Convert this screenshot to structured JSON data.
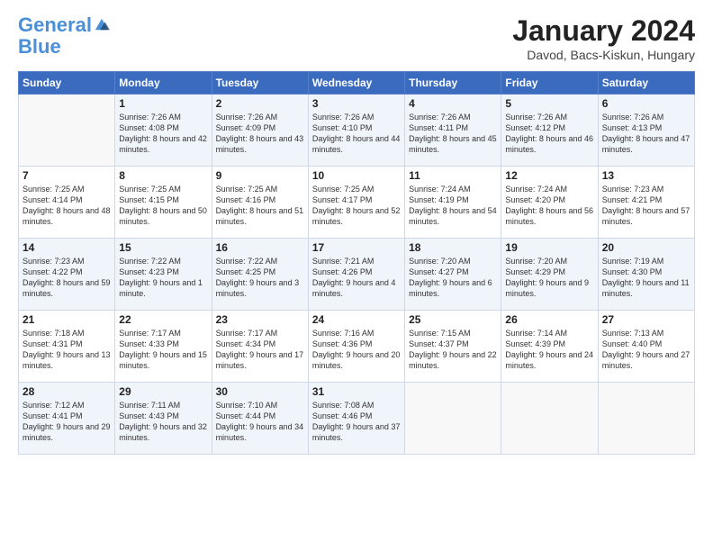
{
  "header": {
    "logo_line1": "General",
    "logo_line2": "Blue",
    "month": "January 2024",
    "location": "Davod, Bacs-Kiskun, Hungary"
  },
  "weekdays": [
    "Sunday",
    "Monday",
    "Tuesday",
    "Wednesday",
    "Thursday",
    "Friday",
    "Saturday"
  ],
  "weeks": [
    [
      {
        "day": "",
        "sunrise": "",
        "sunset": "",
        "daylight": ""
      },
      {
        "day": "1",
        "sunrise": "Sunrise: 7:26 AM",
        "sunset": "Sunset: 4:08 PM",
        "daylight": "Daylight: 8 hours and 42 minutes."
      },
      {
        "day": "2",
        "sunrise": "Sunrise: 7:26 AM",
        "sunset": "Sunset: 4:09 PM",
        "daylight": "Daylight: 8 hours and 43 minutes."
      },
      {
        "day": "3",
        "sunrise": "Sunrise: 7:26 AM",
        "sunset": "Sunset: 4:10 PM",
        "daylight": "Daylight: 8 hours and 44 minutes."
      },
      {
        "day": "4",
        "sunrise": "Sunrise: 7:26 AM",
        "sunset": "Sunset: 4:11 PM",
        "daylight": "Daylight: 8 hours and 45 minutes."
      },
      {
        "day": "5",
        "sunrise": "Sunrise: 7:26 AM",
        "sunset": "Sunset: 4:12 PM",
        "daylight": "Daylight: 8 hours and 46 minutes."
      },
      {
        "day": "6",
        "sunrise": "Sunrise: 7:26 AM",
        "sunset": "Sunset: 4:13 PM",
        "daylight": "Daylight: 8 hours and 47 minutes."
      }
    ],
    [
      {
        "day": "7",
        "sunrise": "Sunrise: 7:25 AM",
        "sunset": "Sunset: 4:14 PM",
        "daylight": "Daylight: 8 hours and 48 minutes."
      },
      {
        "day": "8",
        "sunrise": "Sunrise: 7:25 AM",
        "sunset": "Sunset: 4:15 PM",
        "daylight": "Daylight: 8 hours and 50 minutes."
      },
      {
        "day": "9",
        "sunrise": "Sunrise: 7:25 AM",
        "sunset": "Sunset: 4:16 PM",
        "daylight": "Daylight: 8 hours and 51 minutes."
      },
      {
        "day": "10",
        "sunrise": "Sunrise: 7:25 AM",
        "sunset": "Sunset: 4:17 PM",
        "daylight": "Daylight: 8 hours and 52 minutes."
      },
      {
        "day": "11",
        "sunrise": "Sunrise: 7:24 AM",
        "sunset": "Sunset: 4:19 PM",
        "daylight": "Daylight: 8 hours and 54 minutes."
      },
      {
        "day": "12",
        "sunrise": "Sunrise: 7:24 AM",
        "sunset": "Sunset: 4:20 PM",
        "daylight": "Daylight: 8 hours and 56 minutes."
      },
      {
        "day": "13",
        "sunrise": "Sunrise: 7:23 AM",
        "sunset": "Sunset: 4:21 PM",
        "daylight": "Daylight: 8 hours and 57 minutes."
      }
    ],
    [
      {
        "day": "14",
        "sunrise": "Sunrise: 7:23 AM",
        "sunset": "Sunset: 4:22 PM",
        "daylight": "Daylight: 8 hours and 59 minutes."
      },
      {
        "day": "15",
        "sunrise": "Sunrise: 7:22 AM",
        "sunset": "Sunset: 4:23 PM",
        "daylight": "Daylight: 9 hours and 1 minute."
      },
      {
        "day": "16",
        "sunrise": "Sunrise: 7:22 AM",
        "sunset": "Sunset: 4:25 PM",
        "daylight": "Daylight: 9 hours and 3 minutes."
      },
      {
        "day": "17",
        "sunrise": "Sunrise: 7:21 AM",
        "sunset": "Sunset: 4:26 PM",
        "daylight": "Daylight: 9 hours and 4 minutes."
      },
      {
        "day": "18",
        "sunrise": "Sunrise: 7:20 AM",
        "sunset": "Sunset: 4:27 PM",
        "daylight": "Daylight: 9 hours and 6 minutes."
      },
      {
        "day": "19",
        "sunrise": "Sunrise: 7:20 AM",
        "sunset": "Sunset: 4:29 PM",
        "daylight": "Daylight: 9 hours and 9 minutes."
      },
      {
        "day": "20",
        "sunrise": "Sunrise: 7:19 AM",
        "sunset": "Sunset: 4:30 PM",
        "daylight": "Daylight: 9 hours and 11 minutes."
      }
    ],
    [
      {
        "day": "21",
        "sunrise": "Sunrise: 7:18 AM",
        "sunset": "Sunset: 4:31 PM",
        "daylight": "Daylight: 9 hours and 13 minutes."
      },
      {
        "day": "22",
        "sunrise": "Sunrise: 7:17 AM",
        "sunset": "Sunset: 4:33 PM",
        "daylight": "Daylight: 9 hours and 15 minutes."
      },
      {
        "day": "23",
        "sunrise": "Sunrise: 7:17 AM",
        "sunset": "Sunset: 4:34 PM",
        "daylight": "Daylight: 9 hours and 17 minutes."
      },
      {
        "day": "24",
        "sunrise": "Sunrise: 7:16 AM",
        "sunset": "Sunset: 4:36 PM",
        "daylight": "Daylight: 9 hours and 20 minutes."
      },
      {
        "day": "25",
        "sunrise": "Sunrise: 7:15 AM",
        "sunset": "Sunset: 4:37 PM",
        "daylight": "Daylight: 9 hours and 22 minutes."
      },
      {
        "day": "26",
        "sunrise": "Sunrise: 7:14 AM",
        "sunset": "Sunset: 4:39 PM",
        "daylight": "Daylight: 9 hours and 24 minutes."
      },
      {
        "day": "27",
        "sunrise": "Sunrise: 7:13 AM",
        "sunset": "Sunset: 4:40 PM",
        "daylight": "Daylight: 9 hours and 27 minutes."
      }
    ],
    [
      {
        "day": "28",
        "sunrise": "Sunrise: 7:12 AM",
        "sunset": "Sunset: 4:41 PM",
        "daylight": "Daylight: 9 hours and 29 minutes."
      },
      {
        "day": "29",
        "sunrise": "Sunrise: 7:11 AM",
        "sunset": "Sunset: 4:43 PM",
        "daylight": "Daylight: 9 hours and 32 minutes."
      },
      {
        "day": "30",
        "sunrise": "Sunrise: 7:10 AM",
        "sunset": "Sunset: 4:44 PM",
        "daylight": "Daylight: 9 hours and 34 minutes."
      },
      {
        "day": "31",
        "sunrise": "Sunrise: 7:08 AM",
        "sunset": "Sunset: 4:46 PM",
        "daylight": "Daylight: 9 hours and 37 minutes."
      },
      {
        "day": "",
        "sunrise": "",
        "sunset": "",
        "daylight": ""
      },
      {
        "day": "",
        "sunrise": "",
        "sunset": "",
        "daylight": ""
      },
      {
        "day": "",
        "sunrise": "",
        "sunset": "",
        "daylight": ""
      }
    ]
  ]
}
